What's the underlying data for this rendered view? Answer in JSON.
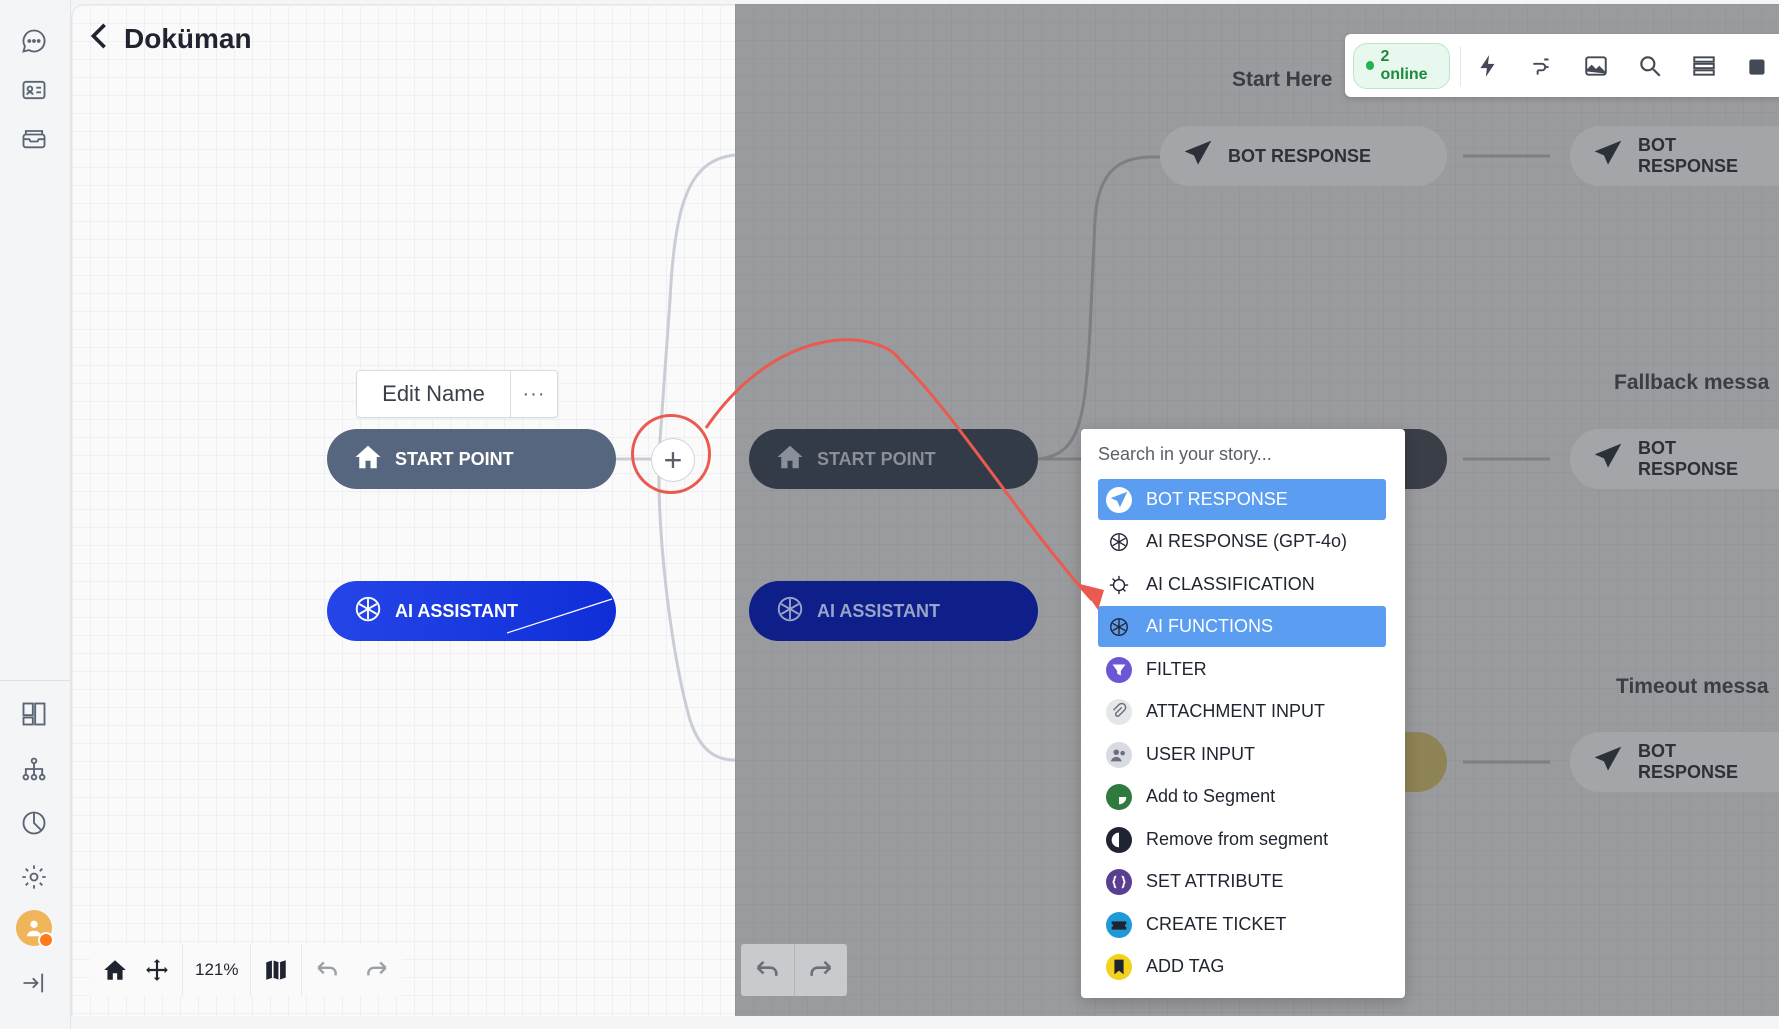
{
  "header": {
    "title": "Doküman"
  },
  "canvas": {
    "edit_name": "Edit Name",
    "more_label": "···",
    "left_nodes": {
      "start": "START POINT",
      "ai": "AI ASSISTANT"
    },
    "right_nodes": {
      "start": "START POINT",
      "ai": "AI ASSISTANT"
    },
    "sections": {
      "start_here": "Start Here",
      "fallback": "Fallback messa",
      "timeout": "Timeout messa"
    },
    "bot_response": "BOT RESPONSE"
  },
  "toolbar": {
    "online": "2 online"
  },
  "menu": {
    "search_placeholder": "Search in your story...",
    "items": [
      {
        "label": "BOT RESPONSE",
        "icon": "paper-plane-icon",
        "selected": true
      },
      {
        "label": "AI RESPONSE (GPT-4o)",
        "icon": "openai-icon",
        "selected": false
      },
      {
        "label": "AI CLASSIFICATION",
        "icon": "ai-classification-icon",
        "selected": false
      },
      {
        "label": "AI FUNCTIONS",
        "icon": "openai-icon",
        "selected": true
      },
      {
        "label": "FILTER",
        "icon": "filter-icon",
        "selected": false
      },
      {
        "label": "ATTACHMENT INPUT",
        "icon": "paperclip-icon",
        "selected": false
      },
      {
        "label": "USER INPUT",
        "icon": "users-icon",
        "selected": false
      },
      {
        "label": "Add to Segment",
        "icon": "segment-add-icon",
        "selected": false
      },
      {
        "label": "Remove from segment",
        "icon": "segment-remove-icon",
        "selected": false
      },
      {
        "label": "SET ATTRIBUTE",
        "icon": "attribute-icon",
        "selected": false
      },
      {
        "label": "CREATE TICKET",
        "icon": "ticket-icon",
        "selected": false
      },
      {
        "label": "ADD TAG",
        "icon": "tag-icon",
        "selected": false
      }
    ]
  },
  "bottom": {
    "zoom": "121%"
  },
  "colors": {
    "accent": "#5b9df1",
    "highlight_ring": "#ea5a4f",
    "online": "#22b34f"
  }
}
